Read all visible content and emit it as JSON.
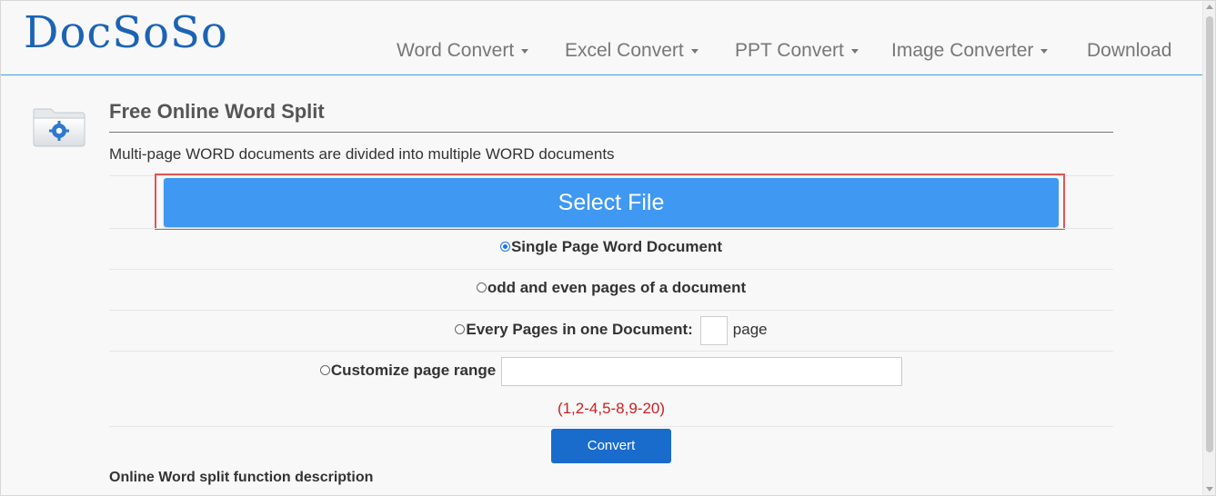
{
  "brand": {
    "logo_text": "DocSoSo"
  },
  "nav": {
    "items": [
      {
        "label": "Word Convert",
        "has_caret": true
      },
      {
        "label": "Excel Convert",
        "has_caret": true
      },
      {
        "label": "PPT Convert",
        "has_caret": true
      },
      {
        "label": "Image Converter",
        "has_caret": true
      },
      {
        "label": "Download",
        "has_caret": false
      }
    ]
  },
  "tool": {
    "icon": "folder-gear-icon",
    "title": "Free Online Word Split",
    "subtitle": "Multi-page WORD documents are divided into multiple WORD documents",
    "select_file_label": "Select File",
    "options": {
      "single": "Single Page Word Document",
      "odd_even": "odd and even pages of a document",
      "every_pages": "Every Pages in one Document:",
      "every_pages_unit": "page",
      "custom_range": "Customize page range"
    },
    "selected_option": "single",
    "range_hint": "(1,2-4,5-8,9-20)",
    "convert_label": "Convert",
    "description_heading": "Online Word split function description"
  },
  "colors": {
    "select_button": "#3f98f2",
    "convert_button": "#1a6ccc",
    "highlight_border": "#e05555",
    "hint_text": "#cc1f1f",
    "logo": "#1c63b3"
  }
}
